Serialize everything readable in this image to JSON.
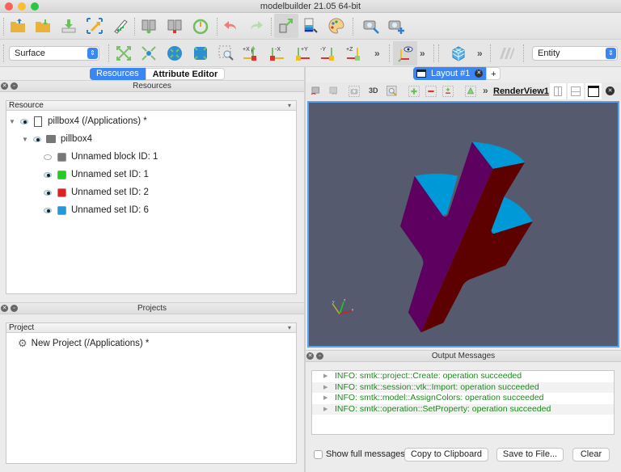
{
  "window": {
    "title": "modelbuilder 21.05 64-bit"
  },
  "toolbar_main": {
    "icons": [
      "open-folder-icon",
      "save-folder-icon",
      "download-icon",
      "reset-camera-arrow-icon",
      "python-flask-icon",
      "connect-server-icon",
      "disconnect-server-icon",
      "timer-icon",
      "undo-icon",
      "redo-icon",
      "interaction-mode-icon",
      "color-map-icon",
      "palette-icon",
      "camera-zoom-icon",
      "camera-add-icon"
    ]
  },
  "toolbar_view": {
    "representation_select": "Surface",
    "entity_select": "Entity",
    "camera_labels": {
      "px": "+X",
      "mx": "-X",
      "py": "+Y",
      "my": "-Y",
      "pz": "+Z"
    },
    "more_label": "»"
  },
  "left_tabs": [
    {
      "label": "Resources",
      "active": true
    },
    {
      "label": "Attribute Editor",
      "active": false
    }
  ],
  "resources_panel": {
    "title": "Resources",
    "column_header": "Resource",
    "items": [
      {
        "label": "pillbox4 (/Applications) *",
        "level": 0,
        "visible": true,
        "icon": "document-icon"
      },
      {
        "label": "pillbox4",
        "level": 1,
        "visible": true,
        "icon": "model-icon"
      },
      {
        "label": "Unnamed block ID: 1",
        "level": 2,
        "visible": false,
        "color": "#777777"
      },
      {
        "label": "Unnamed set ID: 1",
        "level": 2,
        "visible": true,
        "color": "#22cc22"
      },
      {
        "label": "Unnamed set ID: 2",
        "level": 2,
        "visible": true,
        "color": "#dd2222"
      },
      {
        "label": "Unnamed set ID: 6",
        "level": 2,
        "visible": true,
        "color": "#2299dd"
      }
    ]
  },
  "projects_panel": {
    "title": "Projects",
    "column_header": "Project",
    "items": [
      {
        "label": "New Project (/Applications) *"
      }
    ]
  },
  "layout_tab": {
    "label": "Layout #1",
    "add_label": "+"
  },
  "view_toolbar": {
    "three_d_label": "3D",
    "view_name": "RenderView1",
    "more_label": "»"
  },
  "render_view": {
    "background": "#555a6e",
    "colors": {
      "purple_face": "#5e0060",
      "red_face": "#5c0000",
      "blue_face": "#0099d8"
    },
    "axes": {
      "x": "x",
      "y": "y",
      "z": "z"
    }
  },
  "output_panel": {
    "title": "Output Messages",
    "messages": [
      "INFO: smtk::project::Create: operation succeeded",
      "INFO: smtk::session::vtk::Import: operation succeeded",
      "INFO: smtk::model::AssignColors: operation succeeded",
      "INFO: smtk::operation::SetProperty: operation succeeded"
    ],
    "show_full_label": "Show full messages",
    "show_full_checked": false,
    "copy_label": "Copy to Clipboard",
    "save_label": "Save to File...",
    "clear_label": "Clear"
  }
}
